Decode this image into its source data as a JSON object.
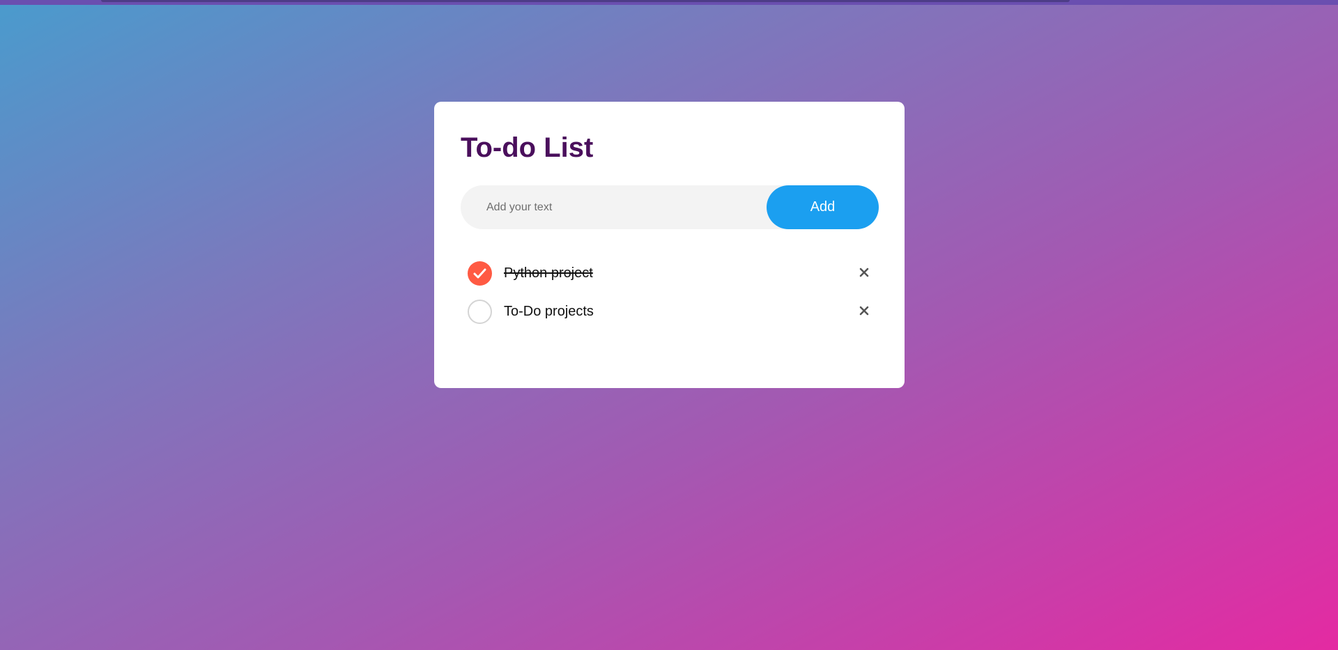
{
  "app": {
    "title": "To-do List"
  },
  "input": {
    "placeholder": "Add your text",
    "value": ""
  },
  "add_button": {
    "label": "Add"
  },
  "todos": [
    {
      "text": "Python project",
      "done": true
    },
    {
      "text": "To-Do projects",
      "done": false
    }
  ],
  "icons": {
    "check": "checkmark-icon",
    "delete": "close-icon"
  },
  "colors": {
    "title": "#4a0f5c",
    "accent": "#1b9ff0",
    "checked": "#ff5a43"
  }
}
